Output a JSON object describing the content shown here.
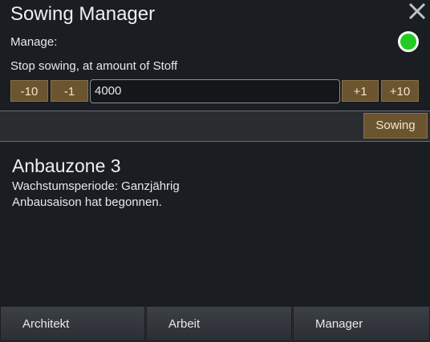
{
  "window": {
    "title": "Sowing Manager",
    "close_icon": "close-x-icon"
  },
  "manager": {
    "manage_label": "Manage:",
    "manage_enabled": true,
    "manage_color": "#22cc22",
    "stop_label": "Stop sowing, at amount of Stoff",
    "buttons": {
      "minus10": "-10",
      "minus1": "-1",
      "plus1": "+1",
      "plus10": "+10"
    },
    "amount_value": "4000",
    "sowing_button": "Sowing"
  },
  "zone": {
    "title": "Anbauzone 3",
    "line1": "Wachstumsperiode: Ganzjährig",
    "line2": "Anbausaison hat begonnen."
  },
  "tabs": [
    "Architekt",
    "Arbeit",
    "Manager"
  ]
}
